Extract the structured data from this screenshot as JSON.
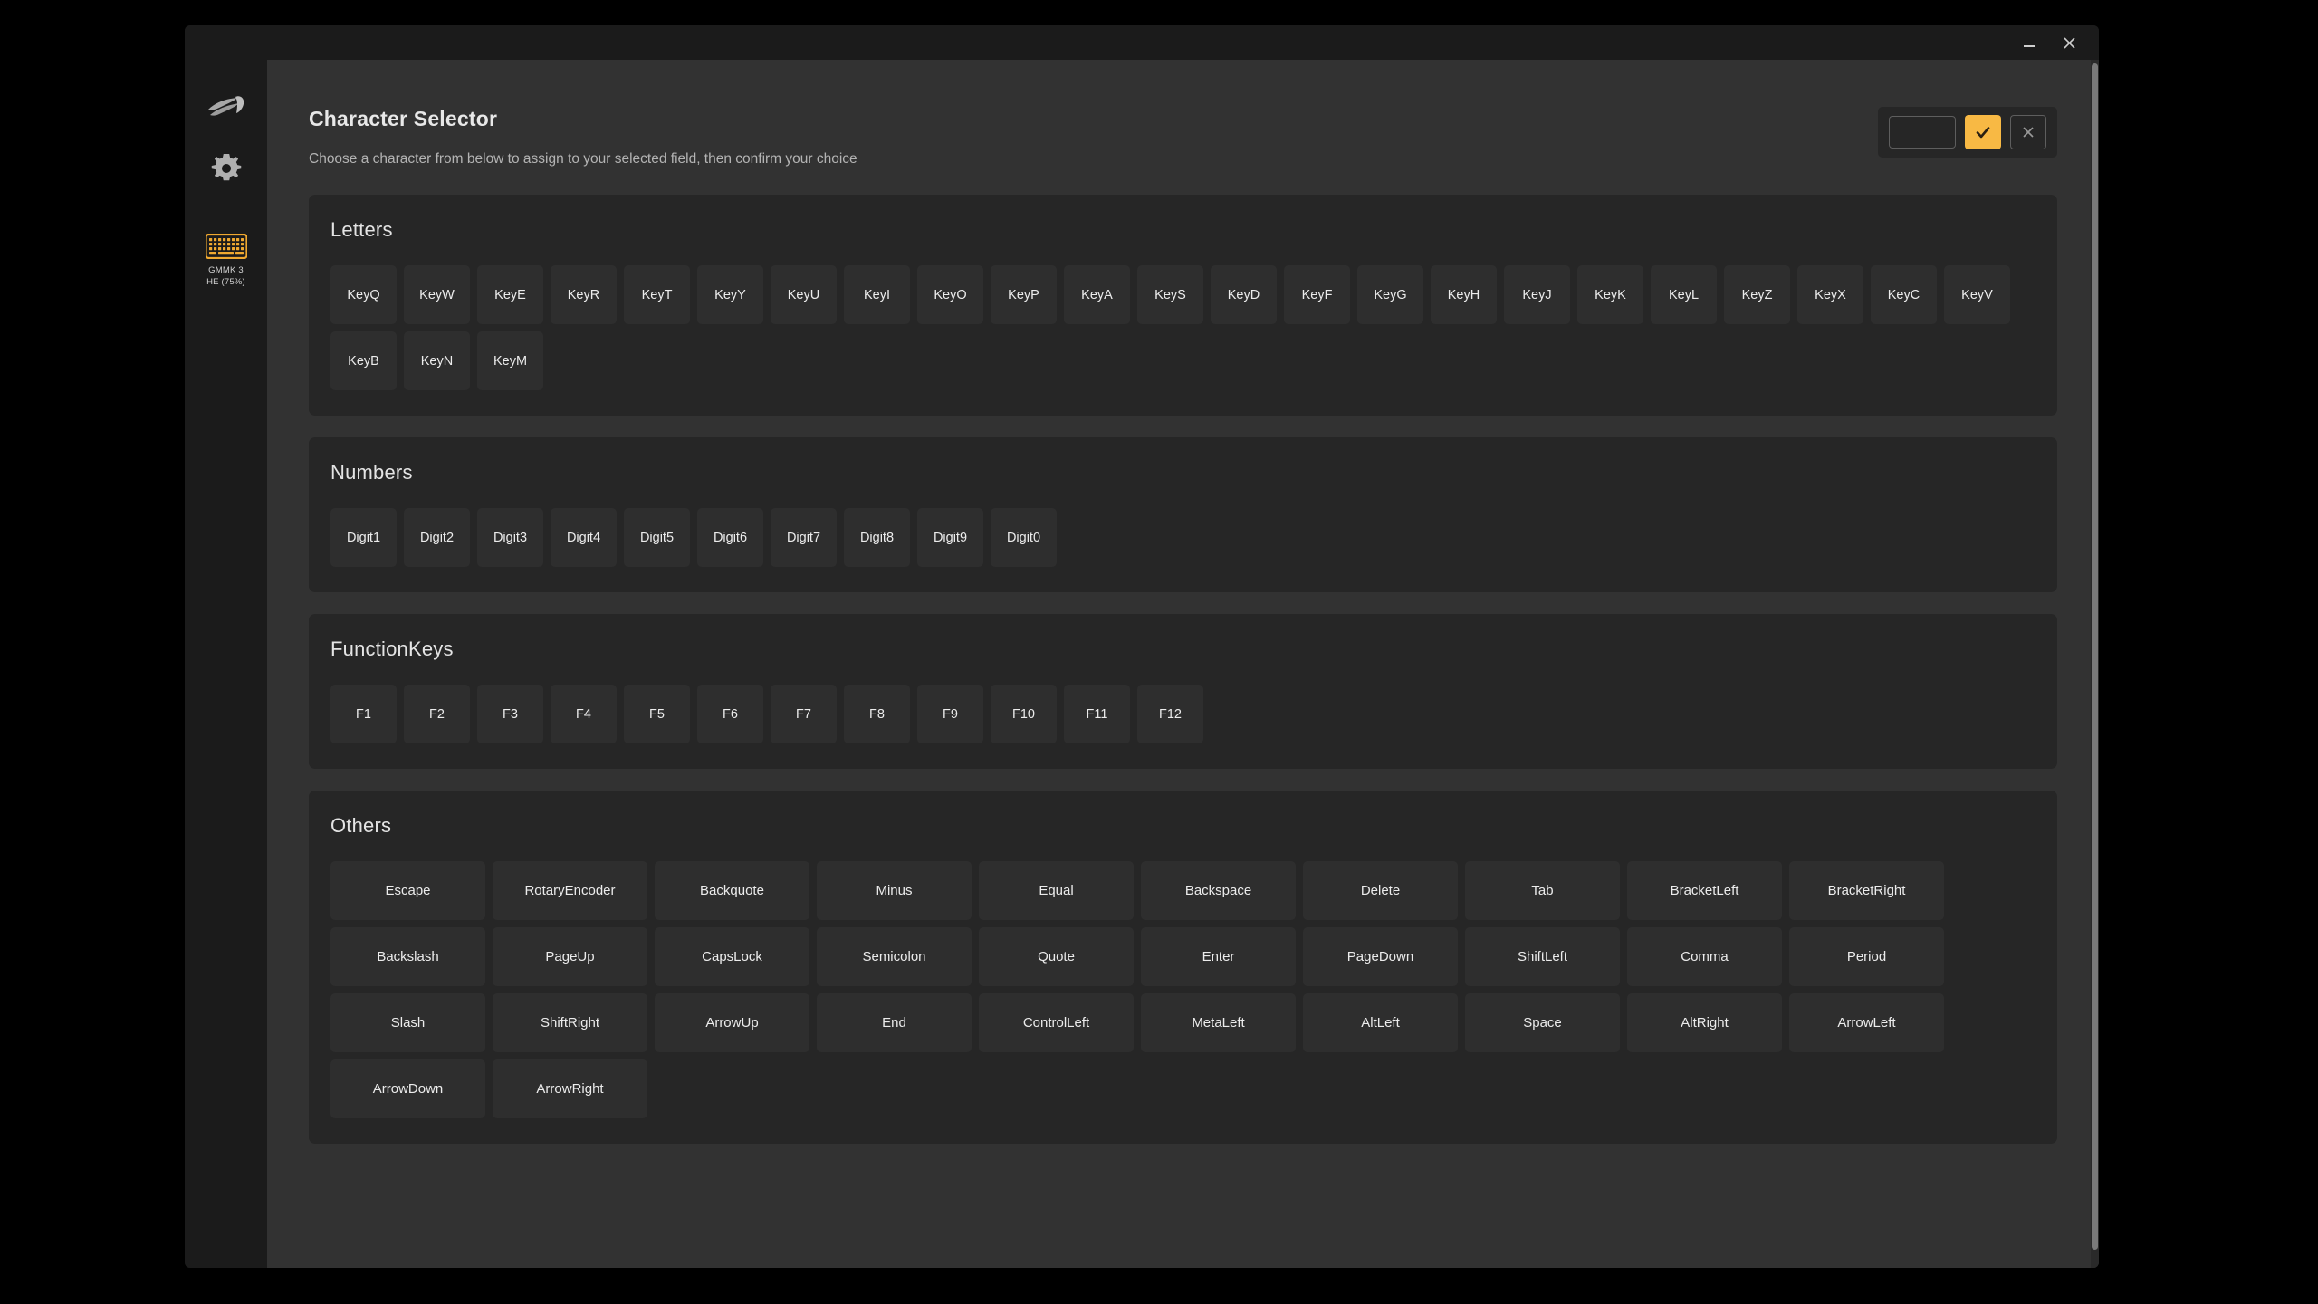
{
  "window": {
    "minimize_label": "—",
    "close_label": "✕"
  },
  "sidebar": {
    "logo_icon": "glorious-logo-icon",
    "settings_icon": "gear-icon",
    "device": {
      "icon": "keyboard-icon",
      "label": "GMMK 3\nHE (75%)"
    }
  },
  "header": {
    "title": "Character Selector",
    "subtitle": "Choose a character from below to assign to your selected field, then confirm your choice",
    "actions": {
      "preview_value": "",
      "confirm_icon": "check-icon",
      "cancel_icon": "close-icon"
    }
  },
  "colors": {
    "accent": "#f8b944",
    "window_bg": "#1b1b1b",
    "content_bg": "#323232",
    "section_bg": "#262626",
    "key_bg": "#2e2e2e",
    "text_primary": "#ececec",
    "text_secondary": "#b4b4b4"
  },
  "sections": [
    {
      "id": "letters",
      "title": "Letters",
      "keys": [
        "KeyQ",
        "KeyW",
        "KeyE",
        "KeyR",
        "KeyT",
        "KeyY",
        "KeyU",
        "KeyI",
        "KeyO",
        "KeyP",
        "KeyA",
        "KeyS",
        "KeyD",
        "KeyF",
        "KeyG",
        "KeyH",
        "KeyJ",
        "KeyK",
        "KeyL",
        "KeyZ",
        "KeyX",
        "KeyC",
        "KeyV",
        "KeyB",
        "KeyN",
        "KeyM"
      ]
    },
    {
      "id": "numbers",
      "title": "Numbers",
      "keys": [
        "Digit1",
        "Digit2",
        "Digit3",
        "Digit4",
        "Digit5",
        "Digit6",
        "Digit7",
        "Digit8",
        "Digit9",
        "Digit0"
      ]
    },
    {
      "id": "functionkeys",
      "title": "FunctionKeys",
      "keys": [
        "F1",
        "F2",
        "F3",
        "F4",
        "F5",
        "F6",
        "F7",
        "F8",
        "F9",
        "F10",
        "F11",
        "F12"
      ]
    },
    {
      "id": "others",
      "title": "Others",
      "keys": [
        "Escape",
        "RotaryEncoder",
        "Backquote",
        "Minus",
        "Equal",
        "Backspace",
        "Delete",
        "Tab",
        "BracketLeft",
        "BracketRight",
        "Backslash",
        "PageUp",
        "CapsLock",
        "Semicolon",
        "Quote",
        "Enter",
        "PageDown",
        "ShiftLeft",
        "Comma",
        "Period",
        "Slash",
        "ShiftRight",
        "ArrowUp",
        "End",
        "ControlLeft",
        "MetaLeft",
        "AltLeft",
        "Space",
        "AltRight",
        "ArrowLeft",
        "ArrowDown",
        "ArrowRight"
      ]
    }
  ]
}
